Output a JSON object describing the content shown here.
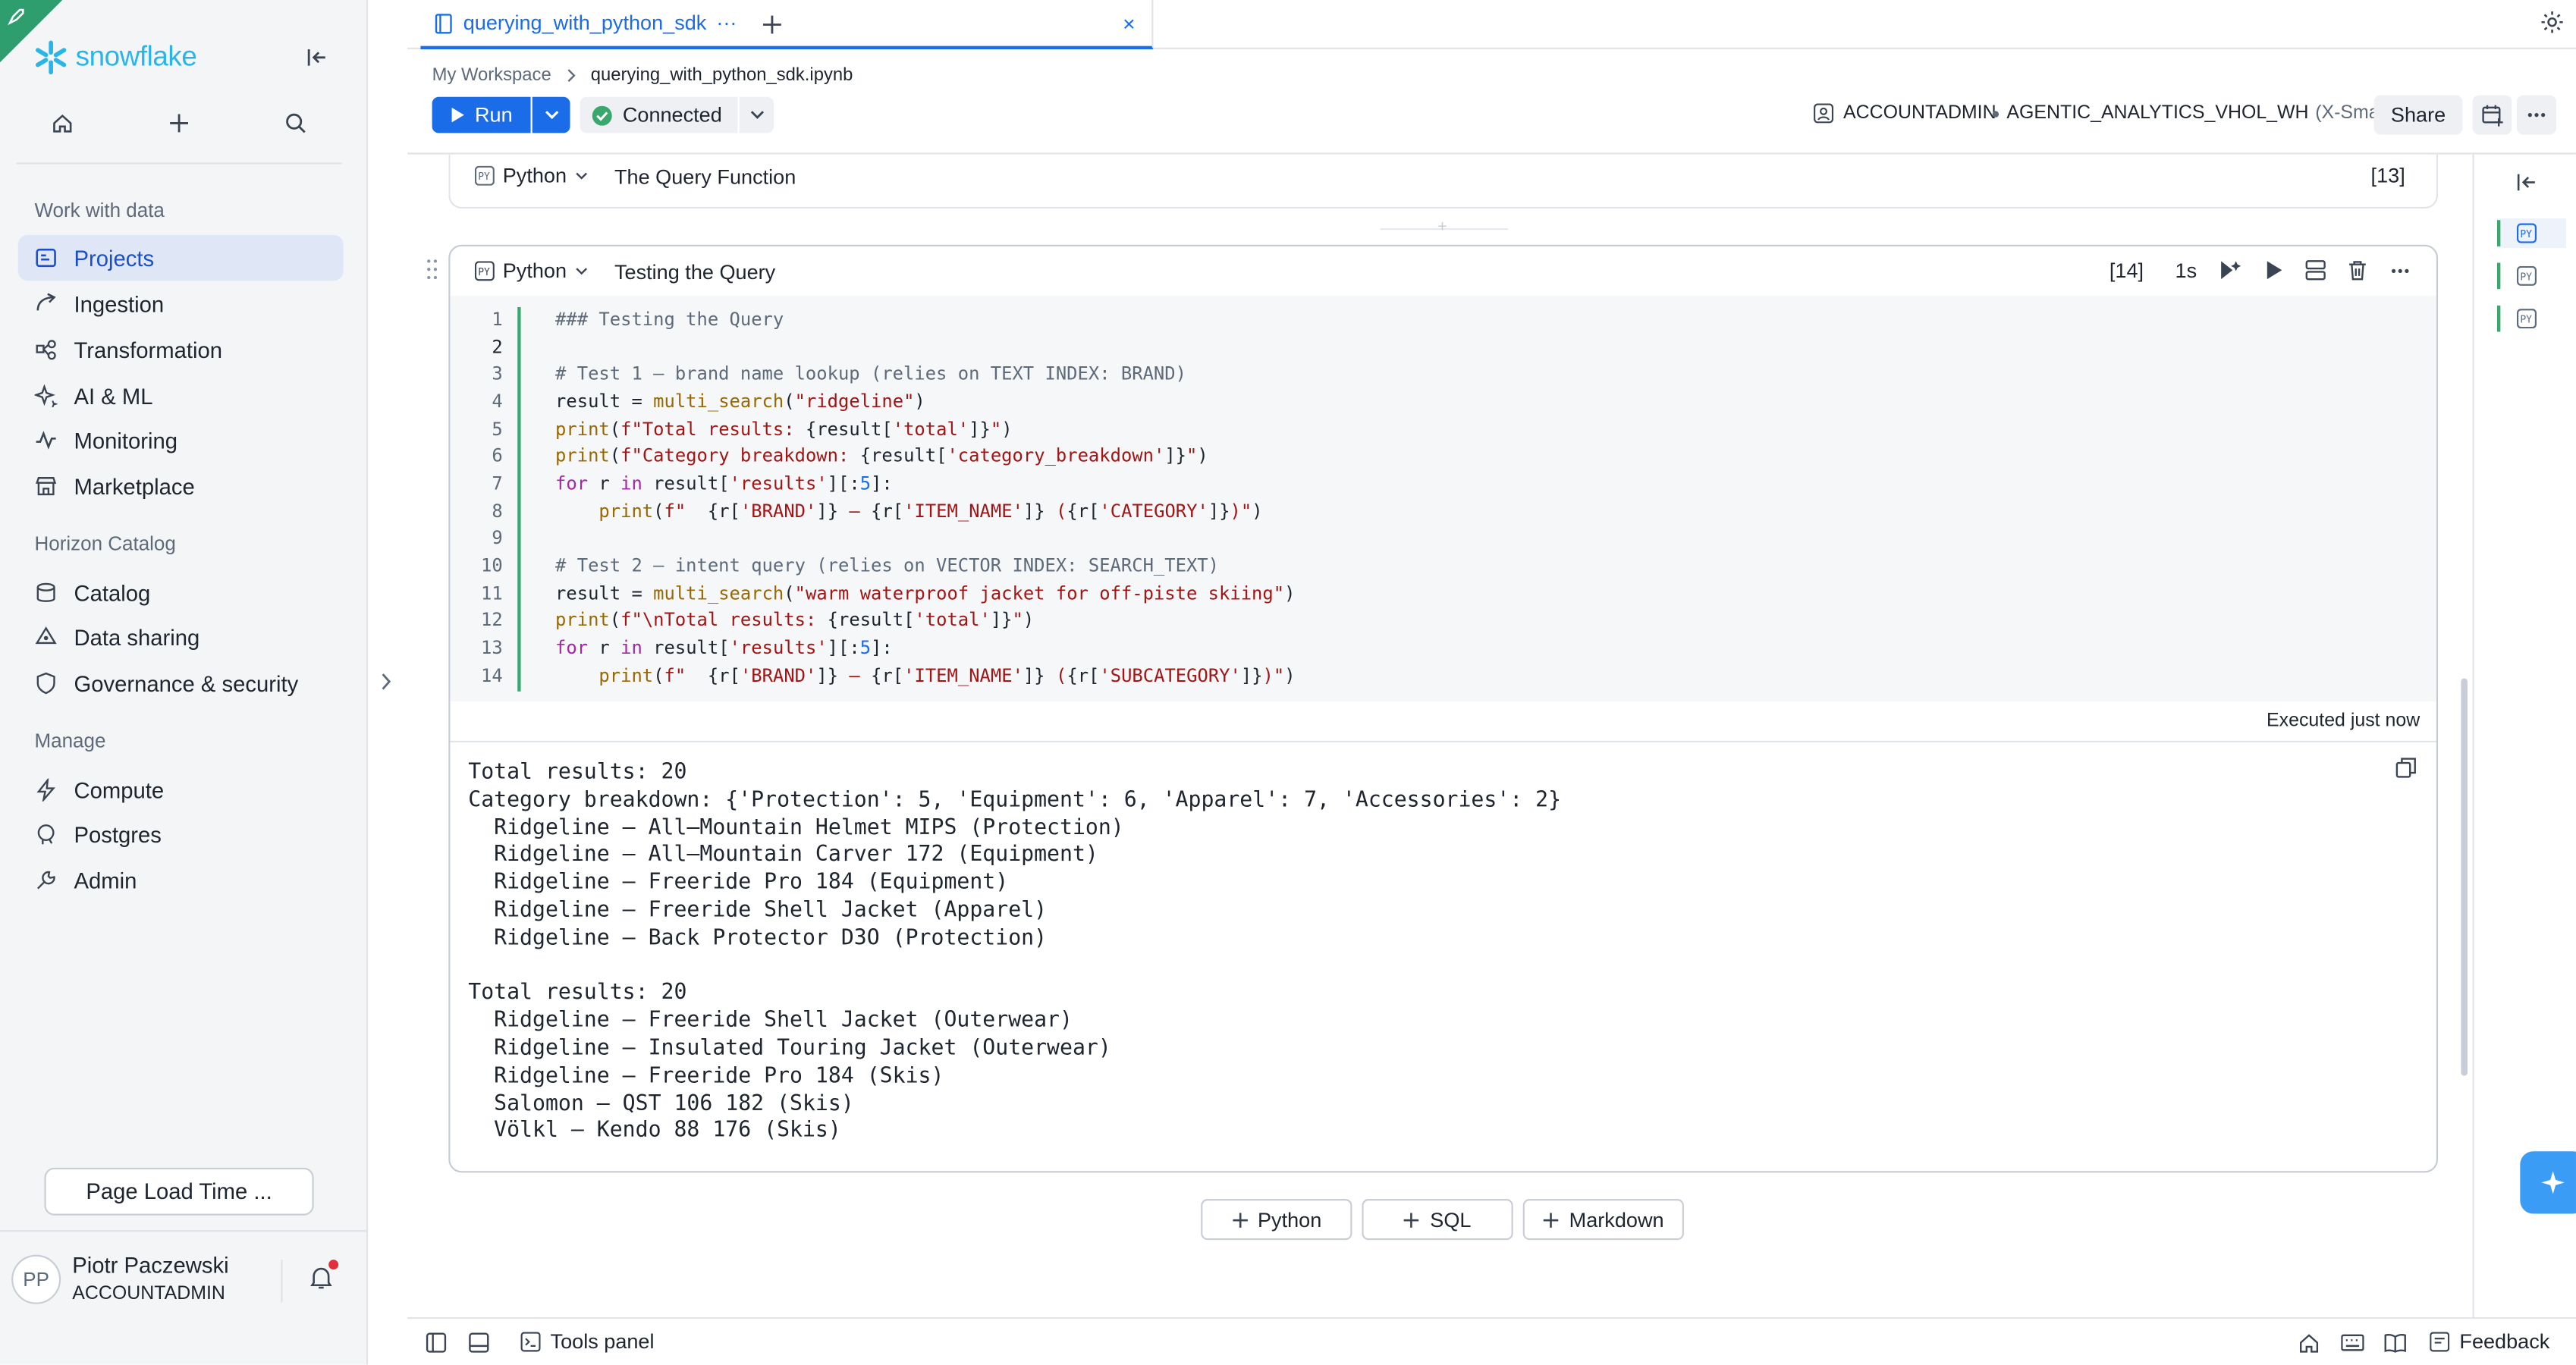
{
  "sidebar": {
    "logo_text": "snowflake",
    "sections": [
      {
        "title": "Work with data",
        "items": [
          {
            "label": "Projects",
            "icon": "projects-icon"
          },
          {
            "label": "Ingestion",
            "icon": "ingestion-icon"
          },
          {
            "label": "Transformation",
            "icon": "transformation-icon"
          },
          {
            "label": "AI & ML",
            "icon": "sparkle-icon"
          },
          {
            "label": "Monitoring",
            "icon": "monitoring-icon"
          },
          {
            "label": "Marketplace",
            "icon": "marketplace-icon"
          }
        ]
      },
      {
        "title": "Horizon Catalog",
        "items": [
          {
            "label": "Catalog",
            "icon": "catalog-icon"
          },
          {
            "label": "Data sharing",
            "icon": "share-icon"
          },
          {
            "label": "Governance & security",
            "icon": "shield-icon"
          }
        ]
      },
      {
        "title": "Manage",
        "items": [
          {
            "label": "Compute",
            "icon": "bolt-icon"
          },
          {
            "label": "Postgres",
            "icon": "postgres-icon"
          },
          {
            "label": "Admin",
            "icon": "admin-icon"
          }
        ]
      }
    ],
    "page_load_button": "Page Load Time ...",
    "user": {
      "initials": "PP",
      "name": "Piotr Paczewski",
      "role": "ACCOUNTADMIN"
    }
  },
  "tab": {
    "title": "querying_with_python_sdk",
    "ellipsis": "···",
    "close": "×"
  },
  "breadcrumb": {
    "workspace": "My Workspace",
    "file": "querying_with_python_sdk.ipynb"
  },
  "toolbar": {
    "run": "Run",
    "status": "Connected",
    "role": "ACCOUNTADMIN",
    "warehouse": "AGENTIC_ANALYTICS_VHOL_WH",
    "warehouse_size": "(X-Small)",
    "share": "Share"
  },
  "cells": [
    {
      "lang": "Python",
      "title": "The Query Function",
      "count": "[13]"
    },
    {
      "lang": "Python",
      "title": "Testing the Query",
      "count": "[14]",
      "duration": "1s",
      "executed": "Executed just now"
    }
  ],
  "code_line_numbers": [
    "1",
    "2",
    "3",
    "4",
    "5",
    "6",
    "7",
    "8",
    "9",
    "10",
    "11",
    "12",
    "13",
    "14"
  ],
  "output_lines": [
    "Total results: 20",
    "Category breakdown: {'Protection': 5, 'Equipment': 6, 'Apparel': 7, 'Accessories': 2}",
    "  Ridgeline — All–Mountain Helmet MIPS (Protection)",
    "  Ridgeline — All–Mountain Carver 172 (Equipment)",
    "  Ridgeline — Freeride Pro 184 (Equipment)",
    "  Ridgeline — Freeride Shell Jacket (Apparel)",
    "  Ridgeline — Back Protector D3O (Protection)",
    "",
    "Total results: 20",
    "  Ridgeline — Freeride Shell Jacket (Outerwear)",
    "  Ridgeline — Insulated Touring Jacket (Outerwear)",
    "  Ridgeline — Freeride Pro 184 (Skis)",
    "  Salomon — QST 106 182 (Skis)",
    "  Völkl — Kendo 88 176 (Skis)"
  ],
  "add_buttons": {
    "python": "Python",
    "sql": "SQL",
    "markdown": "Markdown"
  },
  "bottom": {
    "tools_panel": "Tools panel",
    "feedback": "Feedback"
  },
  "colors": {
    "accent": "#1a6ce8",
    "brand": "#29b5e8",
    "success": "#3aa76d",
    "active_nav_bg": "#dfe7f7"
  }
}
